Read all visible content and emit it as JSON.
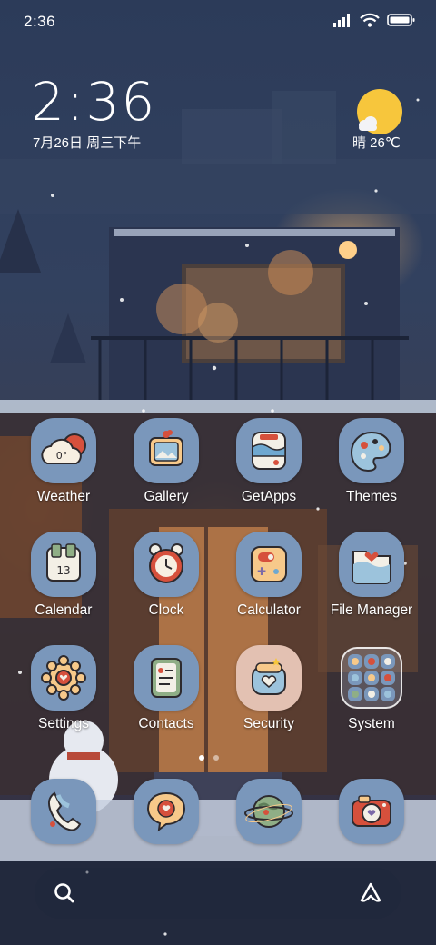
{
  "status_bar": {
    "time": "2:36"
  },
  "clock_widget": {
    "time": "2:36",
    "date": "7月26日 周三下午",
    "weather": "晴 26℃"
  },
  "apps": [
    {
      "label": "Weather",
      "icon": "weather-icon"
    },
    {
      "label": "Gallery",
      "icon": "gallery-icon"
    },
    {
      "label": "GetApps",
      "icon": "getapps-icon"
    },
    {
      "label": "Themes",
      "icon": "themes-icon"
    },
    {
      "label": "Calendar",
      "icon": "calendar-icon"
    },
    {
      "label": "Clock",
      "icon": "clock-icon"
    },
    {
      "label": "Calculator",
      "icon": "calculator-icon"
    },
    {
      "label": "File Manager",
      "icon": "file-manager-icon"
    },
    {
      "label": "Settings",
      "icon": "settings-icon"
    },
    {
      "label": "Contacts",
      "icon": "contacts-icon"
    },
    {
      "label": "Security",
      "icon": "security-icon"
    },
    {
      "label": "System",
      "icon": "folder-icon"
    }
  ],
  "weather_icon_text": "0°",
  "calendar_icon_text": "13",
  "dock": [
    "phone-icon",
    "messaging-icon",
    "browser-icon",
    "camera-icon"
  ],
  "page_indicator": {
    "pages": 2,
    "current": 1
  },
  "colors": {
    "tile": "#7a97bb",
    "sun": "#f7c63c",
    "wallpaper_night": "#2c3b59",
    "warm_light": "#ffbe6e"
  }
}
